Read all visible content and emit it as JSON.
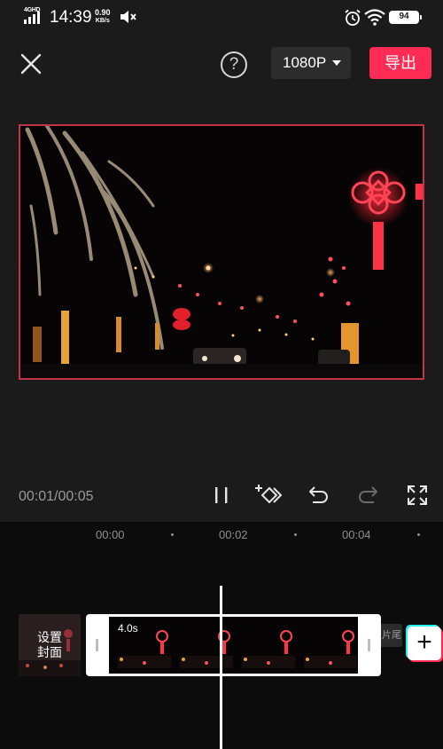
{
  "status_bar": {
    "network": "4GHD",
    "time": "14:39",
    "speed_value": "0.90",
    "speed_unit": "KB/s",
    "battery": "94",
    "icons": [
      "signal-icon",
      "mute-icon",
      "alarm-icon",
      "wifi-icon",
      "battery-icon"
    ]
  },
  "toolbar": {
    "close_icon": "close-icon",
    "help_label": "?",
    "resolution": "1080P",
    "export_label": "导出",
    "accent_color": "#fe2c55"
  },
  "preview": {
    "frame_border_color": "#c2334a"
  },
  "playback": {
    "timecode": "00:01/00:05",
    "controls": [
      "pause-icon",
      "keyframe-icon",
      "undo-icon",
      "redo-icon",
      "fullscreen-icon"
    ]
  },
  "timeline": {
    "ruler": [
      "00:00",
      "00:02",
      "00:04"
    ],
    "cover_label_line1": "设置",
    "cover_label_line2": "封面",
    "clip_duration": "4.0s",
    "tail_label": "片尾",
    "add_label": "+"
  }
}
